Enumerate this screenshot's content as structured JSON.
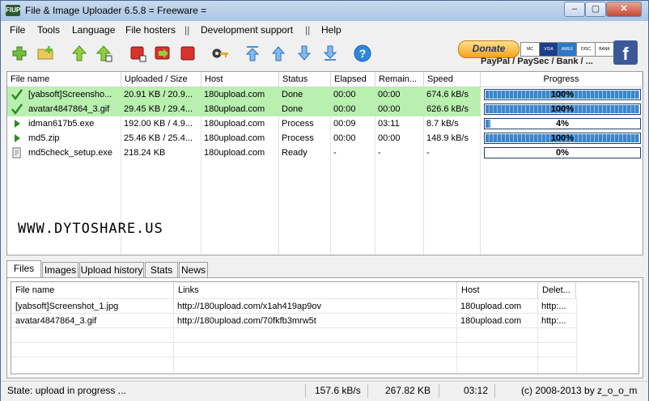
{
  "window": {
    "title": "File & Image Uploader 6.5.8  = Freeware =",
    "app_icon_text": "FIUP"
  },
  "menu": [
    "File",
    "Tools",
    "Language",
    "File hosters",
    "||",
    "Development support",
    "||",
    "Help"
  ],
  "toolbar": {
    "icons": [
      "add-files-icon",
      "add-folder-icon",
      "move-up-green-icon",
      "move-up-all-icon",
      "stop-icon",
      "resume-icon",
      "stop-all-icon",
      "key-icon",
      "arrow-top-icon",
      "arrow-up-icon",
      "arrow-down-icon",
      "arrow-bottom-icon",
      "help-icon"
    ],
    "donate_label": "Donate",
    "cards": [
      "MC",
      "VISA",
      "AMEX",
      "DISC",
      "BANK"
    ],
    "payment_text": "PayPal / PaySec / Bank / ...",
    "facebook_label": "f"
  },
  "uploads": {
    "columns": [
      "File name",
      "Uploaded / Size",
      "Host",
      "Status",
      "Elapsed",
      "Remain...",
      "Speed",
      "Progress"
    ],
    "rows": [
      {
        "name": "[yabsoft]Screensho...",
        "size": "20.91 KB / 20.9...",
        "host": "180upload.com",
        "status": "Done",
        "elapsed": "00:00",
        "remain": "00:00",
        "speed": "674.6 kB/s",
        "progress": "100%",
        "percent": 100,
        "state": "done"
      },
      {
        "name": "avatar4847864_3.gif",
        "size": "29.45 KB / 29.4...",
        "host": "180upload.com",
        "status": "Done",
        "elapsed": "00:00",
        "remain": "00:00",
        "speed": "626.6 kB/s",
        "progress": "100%",
        "percent": 100,
        "state": "done"
      },
      {
        "name": "idman617b5.exe",
        "size": "192.00 KB / 4.9...",
        "host": "180upload.com",
        "status": "Process",
        "elapsed": "00:09",
        "remain": "03:11",
        "speed": "8.7 kB/s",
        "progress": "4%",
        "percent": 4,
        "state": "process"
      },
      {
        "name": "md5.zip",
        "size": "25.46 KB / 25.4...",
        "host": "180upload.com",
        "status": "Process",
        "elapsed": "00:00",
        "remain": "00:00",
        "speed": "148.9 kB/s",
        "progress": "100%",
        "percent": 100,
        "state": "process"
      },
      {
        "name": "md5check_setup.exe",
        "size": "218.24 KB",
        "host": "180upload.com",
        "status": "Ready",
        "elapsed": "-",
        "remain": "-",
        "speed": "-",
        "progress": "0%",
        "percent": 0,
        "state": "ready"
      }
    ]
  },
  "watermark": "WWW.DYTOSHARE.US",
  "tabs": [
    "Files",
    "Images",
    "Upload history",
    "Stats",
    "News"
  ],
  "links": {
    "columns": [
      "File name",
      "Links",
      "Host",
      "Delet..."
    ],
    "rows": [
      {
        "name": "[yabsoft]Screenshot_1.jpg",
        "link": "http://180upload.com/x1ah419ap9ov",
        "host": "180upload.com",
        "delete": "http:..."
      },
      {
        "name": "avatar4847864_3.gif",
        "link": "http://180upload.com/70fkfb3mrw5t",
        "host": "180upload.com",
        "delete": "http:..."
      }
    ]
  },
  "status": {
    "state": "State: upload in progress ...",
    "speed": "157.6 kB/s",
    "size": "267.82 KB",
    "time": "03:12",
    "copyright": "(c) 2008-2013 by z_o_o_m"
  },
  "colors": {
    "done_row": "#b9f0b0",
    "progress_fill": "#3f86c8"
  }
}
